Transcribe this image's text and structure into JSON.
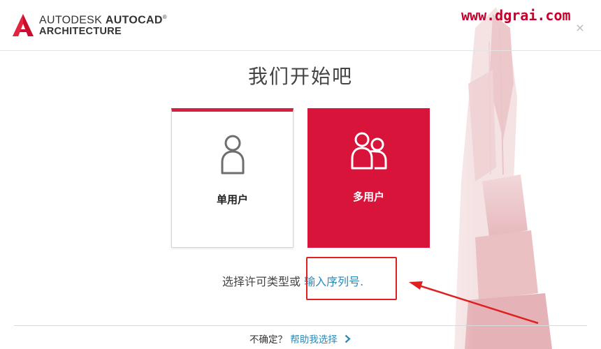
{
  "window": {
    "brand": {
      "line1_regular": "AUTODESK",
      "line1_bold": "AUTOCAD",
      "registered": "®",
      "line2": "ARCHITECTURE"
    },
    "watermark": "www.dgrai.com",
    "close_symbol": "×"
  },
  "main": {
    "heading": "我们开始吧",
    "cards": [
      {
        "label": "单用户",
        "icon": "single-user-icon",
        "selected": false
      },
      {
        "label": "多用户",
        "icon": "multi-user-icon",
        "selected": true
      }
    ],
    "license_prompt": "选择许可类型或",
    "serial_link": "输入序列号",
    "serial_suffix": "."
  },
  "footer": {
    "question": "不确定？",
    "help_link": "帮助我选择"
  },
  "colors": {
    "accent": "#d8143b",
    "link": "#2a8ab8",
    "annotation": "#e02020"
  }
}
